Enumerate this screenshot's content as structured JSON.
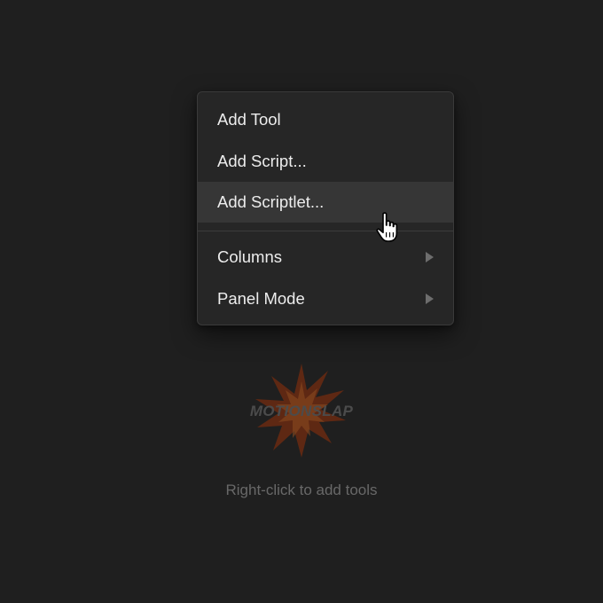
{
  "menu": {
    "items": [
      {
        "label": "Add Tool"
      },
      {
        "label": "Add Script..."
      },
      {
        "label": "Add Scriptlet..."
      },
      {
        "label": "Columns"
      },
      {
        "label": "Panel Mode"
      }
    ],
    "hovered_item": "Add Scriptlet..."
  },
  "logo": {
    "text": "MOTIONSLAP",
    "burst_color": "#7a2e14"
  },
  "hint": {
    "text": "Right-click to add tools"
  },
  "icons": {
    "cursor": "hand-pointer-icon",
    "submenu": "chevron-right-icon"
  },
  "colors": {
    "background": "#1f1f1f",
    "menu_background": "#262626",
    "menu_hover": "#363636",
    "menu_text": "#ededed",
    "hint_text": "#686868"
  }
}
